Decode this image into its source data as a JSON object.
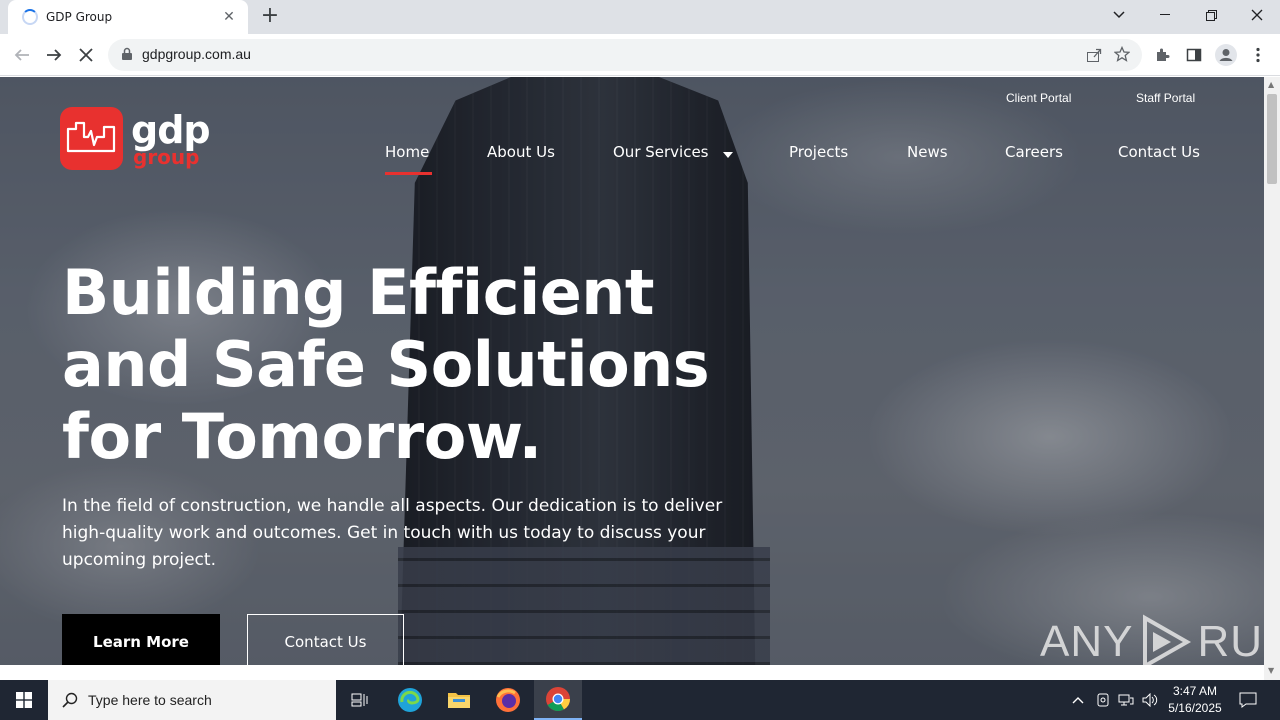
{
  "browser": {
    "tab_title": "GDP Group",
    "url": "gdpgroup.com.au"
  },
  "site": {
    "logo": {
      "word1": "gdp",
      "word2": "group"
    },
    "utility_links": [
      "Client Portal",
      "Staff Portal"
    ],
    "nav": [
      {
        "label": "Home",
        "active": true
      },
      {
        "label": "About Us"
      },
      {
        "label": "Our Services",
        "dropdown": true
      },
      {
        "label": "Projects"
      },
      {
        "label": "News"
      },
      {
        "label": "Careers"
      },
      {
        "label": "Contact Us"
      }
    ],
    "hero": {
      "line1": "Building Efficient",
      "line2": "and Safe Solutions",
      "line3": "for Tomorrow.",
      "subtext": "In the field of construction, we handle all aspects. Our dedication is to deliver high-quality work and outcomes. Get in touch with us today to discuss your upcoming project.",
      "primary_button": "Learn More",
      "secondary_button": "Contact Us"
    },
    "accent_color": "#e8312f"
  },
  "watermark": {
    "left": "ANY",
    "right": "RUN"
  },
  "taskbar": {
    "search_placeholder": "Type here to search",
    "time": "3:47 AM",
    "date": "5/16/2025"
  }
}
